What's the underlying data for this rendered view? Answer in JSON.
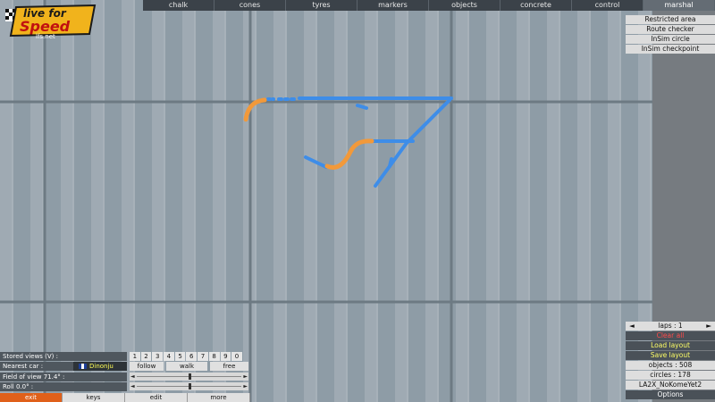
{
  "top_tabs": [
    "chalk",
    "cones",
    "tyres",
    "markers",
    "objects",
    "concrete",
    "control",
    "marshal"
  ],
  "active_tab": "marshal",
  "logo": {
    "line1": "live for",
    "line2": "Speed",
    "url": "lfs.net"
  },
  "marshal_menu": [
    "Restricted area",
    "Route checker",
    "InSim circle",
    "InSim checkpoint"
  ],
  "left_panel": {
    "stored_views_label": "Stored views (V) :",
    "view_numbers": [
      "1",
      "2",
      "3",
      "4",
      "5",
      "6",
      "7",
      "8",
      "9",
      "0"
    ],
    "nearest_car_label": "Nearest car :",
    "nearest_car_name": "Dinonju",
    "follow": "follow",
    "walk": "walk",
    "free": "free",
    "fov_label": "Field of view 71.4° :",
    "roll_label": "Roll 0.0° :",
    "fov_value_fraction": 0.5,
    "roll_value_fraction": 0.5
  },
  "bottom_buttons": [
    "exit",
    "keys",
    "edit",
    "more"
  ],
  "right_panel": {
    "laps": "laps : 1",
    "clear_all": "Clear all",
    "load_layout": "Load layout",
    "save_layout": "Save layout",
    "objects": "objects : 508",
    "circles": "circles : 178",
    "layout_name": "LA2X_NoKomeYet2",
    "options": "Options"
  },
  "colors": {
    "ground": "#8e9ca6",
    "blue_markers": "#3e8de8",
    "orange_markers": "#f2993a",
    "clear_all": "#ff4a4a",
    "layout_yellow": "#ffff66",
    "exit_active": "#e0601a"
  }
}
